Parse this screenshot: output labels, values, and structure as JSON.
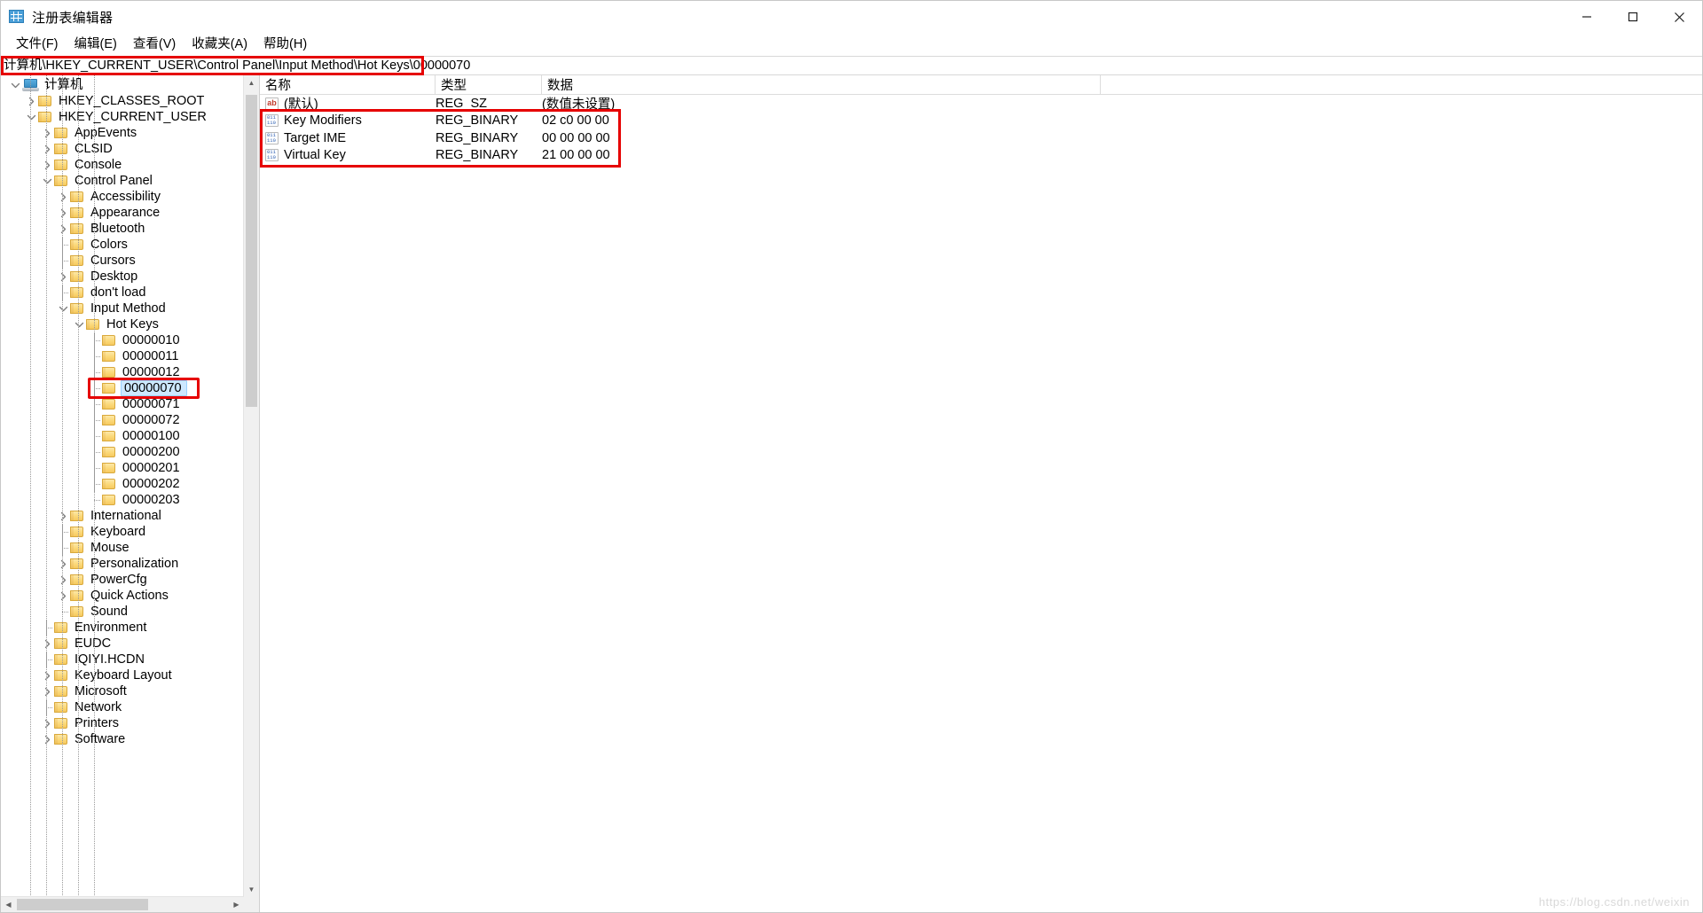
{
  "window": {
    "title": "注册表编辑器",
    "app_icon": "registry-editor-icon",
    "minimize_label": "最小化",
    "maximize_label": "最大化",
    "close_label": "关闭"
  },
  "menu": {
    "items": [
      {
        "label": "文件(F)"
      },
      {
        "label": "编辑(E)"
      },
      {
        "label": "查看(V)"
      },
      {
        "label": "收藏夹(A)"
      },
      {
        "label": "帮助(H)"
      }
    ]
  },
  "address": {
    "value": "计算机\\HKEY_CURRENT_USER\\Control Panel\\Input Method\\Hot Keys\\00000070",
    "placeholder": "计算机"
  },
  "tree": {
    "nodes": [
      {
        "label": "计算机",
        "depth": 0,
        "icon": "computer-icon",
        "state": "expanded",
        "selected": false
      },
      {
        "label": "HKEY_CLASSES_ROOT",
        "depth": 1,
        "icon": "folder-icon",
        "state": "collapsed",
        "selected": false
      },
      {
        "label": "HKEY_CURRENT_USER",
        "depth": 1,
        "icon": "folder-icon",
        "state": "expanded",
        "selected": false
      },
      {
        "label": "AppEvents",
        "depth": 2,
        "icon": "folder-icon",
        "state": "collapsed",
        "selected": false
      },
      {
        "label": "CLSID",
        "depth": 2,
        "icon": "folder-icon",
        "state": "collapsed",
        "selected": false
      },
      {
        "label": "Console",
        "depth": 2,
        "icon": "folder-icon",
        "state": "collapsed",
        "selected": false
      },
      {
        "label": "Control Panel",
        "depth": 2,
        "icon": "folder-icon",
        "state": "expanded",
        "selected": false
      },
      {
        "label": "Accessibility",
        "depth": 3,
        "icon": "folder-icon",
        "state": "collapsed",
        "selected": false
      },
      {
        "label": "Appearance",
        "depth": 3,
        "icon": "folder-icon",
        "state": "collapsed",
        "selected": false
      },
      {
        "label": "Bluetooth",
        "depth": 3,
        "icon": "folder-icon",
        "state": "collapsed",
        "selected": false
      },
      {
        "label": "Colors",
        "depth": 3,
        "icon": "folder-icon",
        "state": "leaf",
        "selected": false
      },
      {
        "label": "Cursors",
        "depth": 3,
        "icon": "folder-icon",
        "state": "leaf",
        "selected": false
      },
      {
        "label": "Desktop",
        "depth": 3,
        "icon": "folder-icon",
        "state": "collapsed",
        "selected": false
      },
      {
        "label": "don't load",
        "depth": 3,
        "icon": "folder-icon",
        "state": "leaf",
        "selected": false
      },
      {
        "label": "Input Method",
        "depth": 3,
        "icon": "folder-icon",
        "state": "expanded",
        "selected": false
      },
      {
        "label": "Hot Keys",
        "depth": 4,
        "icon": "folder-icon",
        "state": "expanded",
        "selected": false
      },
      {
        "label": "00000010",
        "depth": 5,
        "icon": "folder-icon",
        "state": "leaf",
        "selected": false
      },
      {
        "label": "00000011",
        "depth": 5,
        "icon": "folder-icon",
        "state": "leaf",
        "selected": false
      },
      {
        "label": "00000012",
        "depth": 5,
        "icon": "folder-icon",
        "state": "leaf",
        "selected": false
      },
      {
        "label": "00000070",
        "depth": 5,
        "icon": "folder-icon",
        "state": "leaf",
        "selected": true
      },
      {
        "label": "00000071",
        "depth": 5,
        "icon": "folder-icon",
        "state": "leaf",
        "selected": false
      },
      {
        "label": "00000072",
        "depth": 5,
        "icon": "folder-icon",
        "state": "leaf",
        "selected": false
      },
      {
        "label": "00000100",
        "depth": 5,
        "icon": "folder-icon",
        "state": "leaf",
        "selected": false
      },
      {
        "label": "00000200",
        "depth": 5,
        "icon": "folder-icon",
        "state": "leaf",
        "selected": false
      },
      {
        "label": "00000201",
        "depth": 5,
        "icon": "folder-icon",
        "state": "leaf",
        "selected": false
      },
      {
        "label": "00000202",
        "depth": 5,
        "icon": "folder-icon",
        "state": "leaf",
        "selected": false
      },
      {
        "label": "00000203",
        "depth": 5,
        "icon": "folder-icon",
        "state": "leaf",
        "selected": false
      },
      {
        "label": "International",
        "depth": 3,
        "icon": "folder-icon",
        "state": "collapsed",
        "selected": false
      },
      {
        "label": "Keyboard",
        "depth": 3,
        "icon": "folder-icon",
        "state": "leaf",
        "selected": false
      },
      {
        "label": "Mouse",
        "depth": 3,
        "icon": "folder-icon",
        "state": "leaf",
        "selected": false
      },
      {
        "label": "Personalization",
        "depth": 3,
        "icon": "folder-icon",
        "state": "collapsed",
        "selected": false
      },
      {
        "label": "PowerCfg",
        "depth": 3,
        "icon": "folder-icon",
        "state": "collapsed",
        "selected": false
      },
      {
        "label": "Quick Actions",
        "depth": 3,
        "icon": "folder-icon",
        "state": "collapsed",
        "selected": false
      },
      {
        "label": "Sound",
        "depth": 3,
        "icon": "folder-icon",
        "state": "leaf",
        "selected": false
      },
      {
        "label": "Environment",
        "depth": 2,
        "icon": "folder-icon",
        "state": "leaf",
        "selected": false
      },
      {
        "label": "EUDC",
        "depth": 2,
        "icon": "folder-icon",
        "state": "collapsed",
        "selected": false
      },
      {
        "label": "IQIYI.HCDN",
        "depth": 2,
        "icon": "folder-icon",
        "state": "leaf",
        "selected": false
      },
      {
        "label": "Keyboard Layout",
        "depth": 2,
        "icon": "folder-icon",
        "state": "collapsed",
        "selected": false
      },
      {
        "label": "Microsoft",
        "depth": 2,
        "icon": "folder-icon",
        "state": "collapsed",
        "selected": false
      },
      {
        "label": "Network",
        "depth": 2,
        "icon": "folder-icon",
        "state": "leaf",
        "selected": false
      },
      {
        "label": "Printers",
        "depth": 2,
        "icon": "folder-icon",
        "state": "collapsed",
        "selected": false
      },
      {
        "label": "Software",
        "depth": 2,
        "icon": "folder-icon",
        "state": "collapsed",
        "selected": false
      }
    ]
  },
  "values": {
    "columns": {
      "name": "名称",
      "type": "类型",
      "data": "数据"
    },
    "rows": [
      {
        "name": "(默认)",
        "type": "REG_SZ",
        "data": "(数值未设置)",
        "icon": "string-value-icon"
      },
      {
        "name": "Key Modifiers",
        "type": "REG_BINARY",
        "data": "02 c0 00 00",
        "icon": "binary-value-icon"
      },
      {
        "name": "Target IME",
        "type": "REG_BINARY",
        "data": "00 00 00 00",
        "icon": "binary-value-icon"
      },
      {
        "name": "Virtual Key",
        "type": "REG_BINARY",
        "data": "21 00 00 00",
        "icon": "binary-value-icon"
      }
    ]
  },
  "annotations": {
    "color": "#e60000",
    "regions": [
      {
        "name": "address-bar-highlight"
      },
      {
        "name": "selected-key-highlight"
      },
      {
        "name": "binary-values-highlight"
      }
    ]
  },
  "watermark": {
    "text": "https://blog.csdn.net/weixin"
  }
}
